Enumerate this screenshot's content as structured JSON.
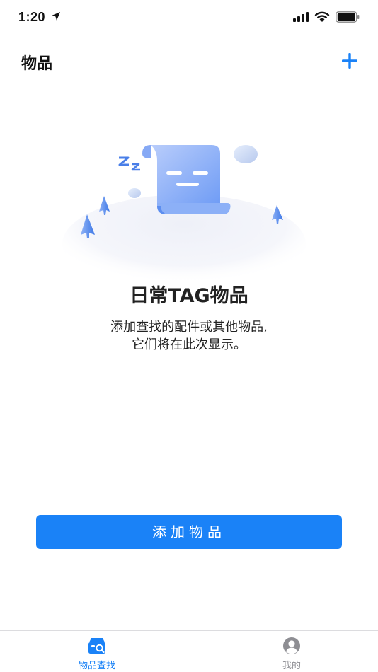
{
  "status_bar": {
    "time": "1:20",
    "icons": [
      "location-arrow-icon",
      "signal-icon",
      "wifi-icon",
      "battery-icon"
    ]
  },
  "nav": {
    "title": "物品",
    "add_icon": "plus-icon"
  },
  "empty_state": {
    "title": "日常TAG物品",
    "desc_line1": "添加查找的配件或其他物品,",
    "desc_line2": "它们将在此次显示。",
    "illustration": "sleeping-scroll-illustration"
  },
  "primary_button": {
    "label": "添加物品"
  },
  "tab_bar": {
    "tabs": [
      {
        "label": "物品查找",
        "icon": "box-search-icon",
        "active": true
      },
      {
        "label": "我的",
        "icon": "user-icon",
        "active": false
      }
    ]
  },
  "colors": {
    "accent": "#1a82f7",
    "text": "#222222",
    "inactive": "#8e8e93",
    "divider": "#e3e3e6"
  }
}
